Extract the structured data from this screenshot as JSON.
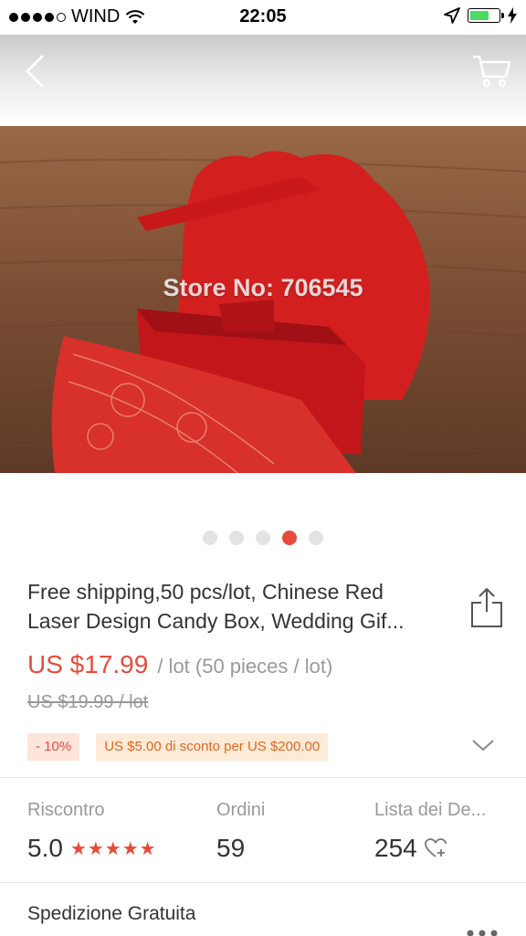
{
  "status_bar": {
    "carrier": "WIND",
    "time": "22:05"
  },
  "nav": {
    "back_icon": "chevron-left-icon",
    "cart_icon": "cart-icon"
  },
  "gallery": {
    "watermark": "Store No: 706545",
    "total_images": 5,
    "active_index": 3
  },
  "product": {
    "title": "Free shipping,50 pcs/lot, Chinese Red Laser Design Candy Box, Wedding Gif...",
    "price": "US $17.99",
    "unit": "/ lot (50 pieces / lot)",
    "original_price": "US $19.99  / lot",
    "discount_badge": "- 10%",
    "coupon_badge": "US $5.00 di sconto per US $200.00"
  },
  "stats": [
    {
      "label": "Riscontro",
      "value": "5.0",
      "stars": "★★★★★"
    },
    {
      "label": "Ordini",
      "value": "59"
    },
    {
      "label": "Lista dei De...",
      "value": "254"
    }
  ],
  "shipping": {
    "label": "Spedizione Gratuita"
  },
  "colors": {
    "accent": "#e84b3a",
    "coupon": "#e0661f",
    "battery": "#4cd964"
  }
}
